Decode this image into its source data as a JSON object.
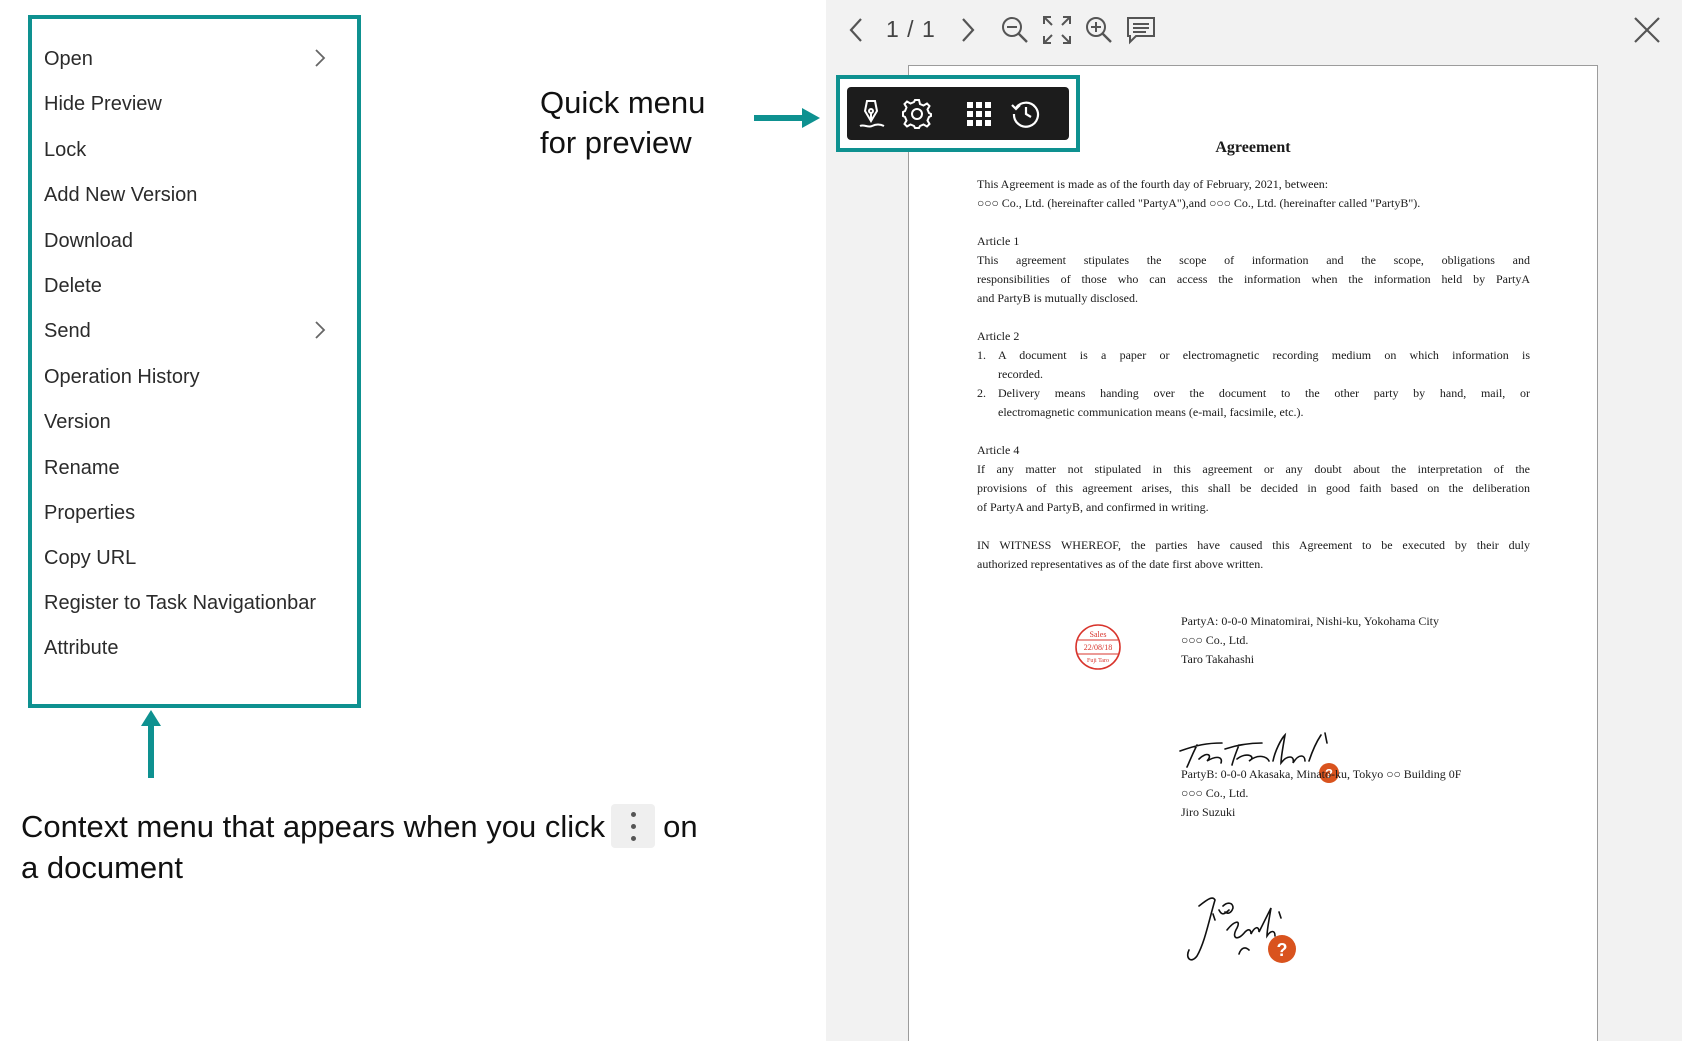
{
  "context_menu": {
    "items": [
      {
        "label": "Open",
        "submenu": true
      },
      {
        "label": "Hide Preview",
        "submenu": false
      },
      {
        "label": "Lock",
        "submenu": false
      },
      {
        "label": "Add New Version",
        "submenu": false
      },
      {
        "label": "Download",
        "submenu": false
      },
      {
        "label": "Delete",
        "submenu": false
      },
      {
        "label": "Send",
        "submenu": true
      },
      {
        "label": "Operation History",
        "submenu": false
      },
      {
        "label": "Version",
        "submenu": false
      },
      {
        "label": "Rename",
        "submenu": false
      },
      {
        "label": "Properties",
        "submenu": false
      },
      {
        "label": "Copy URL",
        "submenu": false
      },
      {
        "label": "Register to Task Navigationbar",
        "submenu": false
      },
      {
        "label": "Attribute",
        "submenu": false
      }
    ]
  },
  "annotations": {
    "quick_menu_line1": "Quick menu",
    "quick_menu_line2": "for preview",
    "context_line1_before": "Context menu that appears when you click",
    "context_line1_after": "on",
    "context_line2": "a document"
  },
  "preview": {
    "page_counter": "1 / 1",
    "toolbar_icons": [
      "chevron-left-icon",
      "chevron-right-icon",
      "zoom-out-icon",
      "fit-screen-icon",
      "zoom-in-icon",
      "comment-icon",
      "close-icon"
    ],
    "quick_menu_icons": [
      "pen-sign-icon",
      "gear-icon",
      "grid-icon",
      "history-icon"
    ]
  },
  "document": {
    "title": "Agreement",
    "intro_1": "This Agreement is made as of the fourth day of February, 2021, between:",
    "intro_2": "○○○ Co., Ltd. (hereinafter called \"PartyA\"),and    ○○○ Co., Ltd. (hereinafter called \"PartyB\").",
    "article1_heading": "Article 1",
    "article1_l1": "This agreement stipulates the scope of information and the scope, obligations and",
    "article1_l2": "responsibilities of those who can access the information when the information held by PartyA",
    "article1_l3": "and PartyB is mutually disclosed.",
    "article2_heading": "Article 2",
    "article2_item1_num": "1.",
    "article2_item1_l1": "A document is a paper or electromagnetic recording medium on which information is",
    "article2_item1_l2": "recorded.",
    "article2_item2_num": "2.",
    "article2_item2_l1": "Delivery means handing over the document to the other party by hand, mail, or",
    "article2_item2_l2": "electromagnetic communication means (e-mail, facsimile, etc.).",
    "article4_heading": "Article 4",
    "article4_l1": "If any matter not stipulated in this agreement or any doubt about the interpretation of the",
    "article4_l2": "provisions of this agreement arises, this shall be decided in good faith based on the deliberation",
    "article4_l3": "of PartyA and PartyB, and confirmed in writing.",
    "witness_l1": "IN WITNESS WHEREOF, the parties have caused this Agreement to be executed by their duly",
    "witness_l2": "authorized representatives as of the date first above written.",
    "seal_top": "Sales",
    "seal_date": "22/08/18",
    "seal_bottom": "Fuji Taro",
    "partyA_address": "PartyA: 0-0-0 Minatomirai, Nishi-ku, Yokohama City",
    "partyA_company": "○○○ Co., Ltd.",
    "partyA_name": "Taro Takahashi",
    "partyB_address": "PartyB: 0-0-0 Akasaka, Minato-ku, Tokyo ○○ Building 0F",
    "partyB_company": "○○○ Co., Ltd.",
    "partyB_name": "Jiro Suzuki",
    "unverified_badge": "?"
  },
  "colors": {
    "accent_teal": "#0e9190",
    "quick_menu_bg": "#1c1c1c",
    "preview_bg": "#f2f2f2",
    "seal_red": "#d8342c",
    "badge_orange": "#d9531e"
  }
}
